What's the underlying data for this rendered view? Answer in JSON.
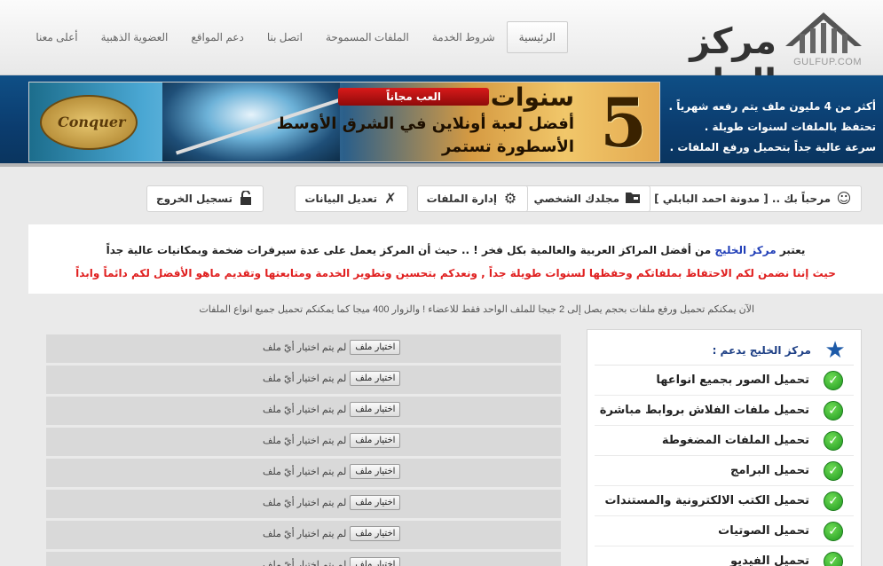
{
  "header": {
    "logo_text": "مركز الخليج",
    "logo_domain": "GULFUP.COM",
    "nav": [
      {
        "label": "الرئيسية",
        "active": true
      },
      {
        "label": "شروط الخدمة"
      },
      {
        "label": "الملفات المسموحة"
      },
      {
        "label": "اتصل بنا"
      },
      {
        "label": "دعم المواقع"
      },
      {
        "label": "العضوية الذهبية"
      },
      {
        "label": "أعلى معنا"
      }
    ]
  },
  "banner": {
    "features": [
      "أكثر من 4 مليون ملف يتم رفعه شهرياً .",
      "تحتفظ بالملفات لسنوات طويلة .",
      "سرعة عالية جداً بتحميل ورفع الملفات ."
    ],
    "ad": {
      "number": "5",
      "years": "سنوات",
      "line1": "أفضل لعبة أونلاين في الشرق الأوسط",
      "line2": "الأسطورة تستمر",
      "play": "العب مجاناً",
      "logo": "Conquer"
    }
  },
  "toolbar": {
    "welcome": "مرحباً بك .. [ مدونة احمد البابلي ]",
    "my_folder": "مجلدك الشخصي",
    "manage_files": "إدارة الملفات",
    "edit_data": "تعديل البيانات",
    "logout": "تسجيل الخروج"
  },
  "intro": {
    "line1_pre": "يعتبر",
    "line1_brand": "مركز الخليج",
    "line1_post": "من أفضل المراكز العربية والعالمية بكل فخر ! .. حيث أن المركز يعمل على عدة سيرفرات ضخمة وبمكانيات عالية جداً",
    "line2": "حيث إننا نضمن لكم الاحتفاظ بملفاتكم وحفظها لسنوات طويلة جداً , ونعدكم بتحسين وتطوير الخدمة ومتابعتها وتقديم ماهو الأفضل لكم دائماً وابداً"
  },
  "limits_text": "الآن يمكنكم تحميل ورفع ملفات بحجم يصل إلى 2 جيجا للملف الواحد فقط للاعضاء ! والزوار 400 ميجا كما يمكنكم تحميل جميع انواع الملفات",
  "sidebar": {
    "title": "مركز الخليج يدعم :",
    "items": [
      "تحميل الصور بجميع انواعها",
      "تحميل ملفات الفلاش بروابط مباشرة",
      "تحميل الملفات المضغوطة",
      "تحميل البرامج",
      "تحميل الكتب الالكترونية والمستندات",
      "تحميل الصوتيات",
      "تحميل الفيديو"
    ]
  },
  "upload": {
    "choose_label": "اختيار ملف",
    "no_file_label": "لم يتم اختيار أيّ ملف"
  }
}
